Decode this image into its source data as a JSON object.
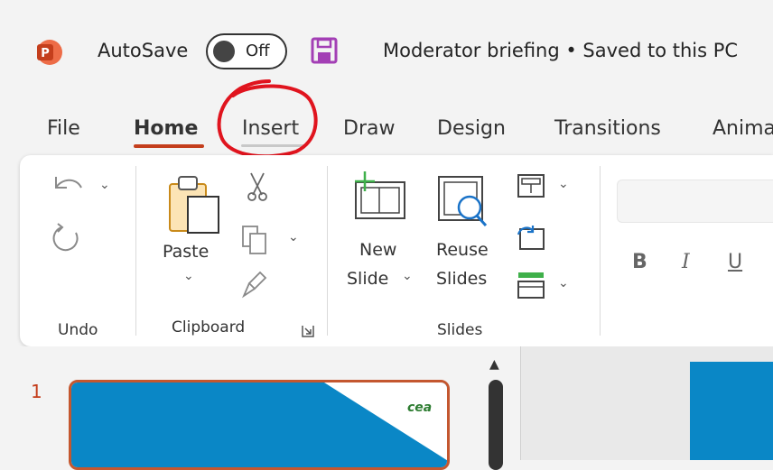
{
  "titlebar": {
    "autosave_label": "AutoSave",
    "autosave_state": "Off",
    "doc_title": "Moderator briefing • Saved to this PC",
    "icons": [
      "powerpoint-icon",
      "save-icon"
    ],
    "brand_color": "#c43e1c"
  },
  "tabs": [
    {
      "label": "File"
    },
    {
      "label": "Home",
      "active": true
    },
    {
      "label": "Insert"
    },
    {
      "label": "Draw"
    },
    {
      "label": "Design"
    },
    {
      "label": "Transitions"
    },
    {
      "label": "Anima"
    }
  ],
  "ribbon": {
    "undo_group": {
      "label": "Undo"
    },
    "clipboard_group": {
      "label": "Clipboard",
      "paste_label": "Paste"
    },
    "slides_group": {
      "label": "Slides",
      "new_slide": [
        "New",
        "Slide"
      ],
      "reuse_slides": [
        "Reuse",
        "Slides"
      ]
    },
    "font_group": {
      "bold": "B",
      "italic": "I",
      "underline": "U"
    }
  },
  "thumbnails": {
    "slide_number": "1",
    "logo_text": "cea",
    "slide_color": "#0a87c6"
  }
}
